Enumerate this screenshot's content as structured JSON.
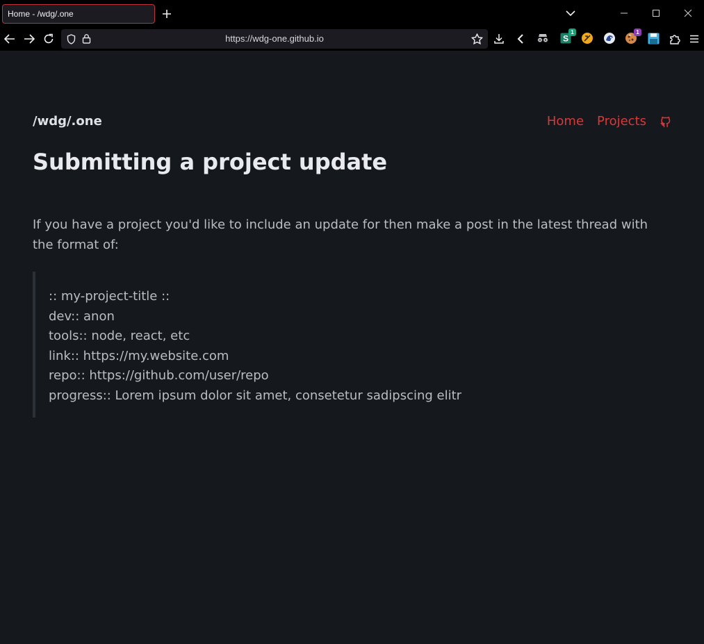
{
  "browser": {
    "tab_title": "Home - /wdg/.one",
    "url": "https://wdg-one.github.io",
    "extensions": [
      {
        "name": "incognito-glasses-icon"
      },
      {
        "name": "s-extension-icon",
        "badge": "1",
        "badge_color": "#1aa37a"
      },
      {
        "name": "orange-extension-icon"
      },
      {
        "name": "privacy-badger-icon"
      },
      {
        "name": "cookie-extension-icon",
        "badge": "1",
        "badge_color": "#8e3db5"
      },
      {
        "name": "save-floppy-icon"
      }
    ]
  },
  "site": {
    "logo": "/wdg/.one",
    "nav": {
      "home": "Home",
      "projects": "Projects"
    },
    "accent": "#d9383a"
  },
  "content": {
    "title": "Submitting a project update",
    "intro": "If you have a project you'd like to include an update for then make a post in the latest thread with the format of:",
    "template_lines": [
      ":: my-project-title ::",
      "dev:: anon",
      "tools:: node, react, etc",
      "link:: https://my.website.com",
      "repo:: https://github.com/user/repo",
      "progress:: Lorem ipsum dolor sit amet, consetetur sadipscing elitr"
    ]
  }
}
